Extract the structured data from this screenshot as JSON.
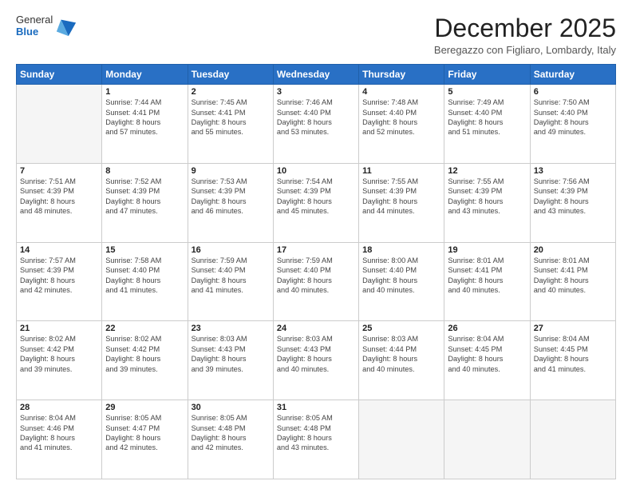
{
  "logo": {
    "general": "General",
    "blue": "Blue"
  },
  "title": "December 2025",
  "location": "Beregazzo con Figliaro, Lombardy, Italy",
  "days_of_week": [
    "Sunday",
    "Monday",
    "Tuesday",
    "Wednesday",
    "Thursday",
    "Friday",
    "Saturday"
  ],
  "weeks": [
    [
      {
        "day": "",
        "info": [],
        "empty": true
      },
      {
        "day": "1",
        "info": [
          "Sunrise: 7:44 AM",
          "Sunset: 4:41 PM",
          "Daylight: 8 hours",
          "and 57 minutes."
        ]
      },
      {
        "day": "2",
        "info": [
          "Sunrise: 7:45 AM",
          "Sunset: 4:41 PM",
          "Daylight: 8 hours",
          "and 55 minutes."
        ]
      },
      {
        "day": "3",
        "info": [
          "Sunrise: 7:46 AM",
          "Sunset: 4:40 PM",
          "Daylight: 8 hours",
          "and 53 minutes."
        ]
      },
      {
        "day": "4",
        "info": [
          "Sunrise: 7:48 AM",
          "Sunset: 4:40 PM",
          "Daylight: 8 hours",
          "and 52 minutes."
        ]
      },
      {
        "day": "5",
        "info": [
          "Sunrise: 7:49 AM",
          "Sunset: 4:40 PM",
          "Daylight: 8 hours",
          "and 51 minutes."
        ]
      },
      {
        "day": "6",
        "info": [
          "Sunrise: 7:50 AM",
          "Sunset: 4:40 PM",
          "Daylight: 8 hours",
          "and 49 minutes."
        ]
      }
    ],
    [
      {
        "day": "7",
        "info": [
          "Sunrise: 7:51 AM",
          "Sunset: 4:39 PM",
          "Daylight: 8 hours",
          "and 48 minutes."
        ]
      },
      {
        "day": "8",
        "info": [
          "Sunrise: 7:52 AM",
          "Sunset: 4:39 PM",
          "Daylight: 8 hours",
          "and 47 minutes."
        ]
      },
      {
        "day": "9",
        "info": [
          "Sunrise: 7:53 AM",
          "Sunset: 4:39 PM",
          "Daylight: 8 hours",
          "and 46 minutes."
        ]
      },
      {
        "day": "10",
        "info": [
          "Sunrise: 7:54 AM",
          "Sunset: 4:39 PM",
          "Daylight: 8 hours",
          "and 45 minutes."
        ]
      },
      {
        "day": "11",
        "info": [
          "Sunrise: 7:55 AM",
          "Sunset: 4:39 PM",
          "Daylight: 8 hours",
          "and 44 minutes."
        ]
      },
      {
        "day": "12",
        "info": [
          "Sunrise: 7:55 AM",
          "Sunset: 4:39 PM",
          "Daylight: 8 hours",
          "and 43 minutes."
        ]
      },
      {
        "day": "13",
        "info": [
          "Sunrise: 7:56 AM",
          "Sunset: 4:39 PM",
          "Daylight: 8 hours",
          "and 43 minutes."
        ]
      }
    ],
    [
      {
        "day": "14",
        "info": [
          "Sunrise: 7:57 AM",
          "Sunset: 4:39 PM",
          "Daylight: 8 hours",
          "and 42 minutes."
        ]
      },
      {
        "day": "15",
        "info": [
          "Sunrise: 7:58 AM",
          "Sunset: 4:40 PM",
          "Daylight: 8 hours",
          "and 41 minutes."
        ]
      },
      {
        "day": "16",
        "info": [
          "Sunrise: 7:59 AM",
          "Sunset: 4:40 PM",
          "Daylight: 8 hours",
          "and 41 minutes."
        ]
      },
      {
        "day": "17",
        "info": [
          "Sunrise: 7:59 AM",
          "Sunset: 4:40 PM",
          "Daylight: 8 hours",
          "and 40 minutes."
        ]
      },
      {
        "day": "18",
        "info": [
          "Sunrise: 8:00 AM",
          "Sunset: 4:40 PM",
          "Daylight: 8 hours",
          "and 40 minutes."
        ]
      },
      {
        "day": "19",
        "info": [
          "Sunrise: 8:01 AM",
          "Sunset: 4:41 PM",
          "Daylight: 8 hours",
          "and 40 minutes."
        ]
      },
      {
        "day": "20",
        "info": [
          "Sunrise: 8:01 AM",
          "Sunset: 4:41 PM",
          "Daylight: 8 hours",
          "and 40 minutes."
        ]
      }
    ],
    [
      {
        "day": "21",
        "info": [
          "Sunrise: 8:02 AM",
          "Sunset: 4:42 PM",
          "Daylight: 8 hours",
          "and 39 minutes."
        ]
      },
      {
        "day": "22",
        "info": [
          "Sunrise: 8:02 AM",
          "Sunset: 4:42 PM",
          "Daylight: 8 hours",
          "and 39 minutes."
        ]
      },
      {
        "day": "23",
        "info": [
          "Sunrise: 8:03 AM",
          "Sunset: 4:43 PM",
          "Daylight: 8 hours",
          "and 39 minutes."
        ]
      },
      {
        "day": "24",
        "info": [
          "Sunrise: 8:03 AM",
          "Sunset: 4:43 PM",
          "Daylight: 8 hours",
          "and 40 minutes."
        ]
      },
      {
        "day": "25",
        "info": [
          "Sunrise: 8:03 AM",
          "Sunset: 4:44 PM",
          "Daylight: 8 hours",
          "and 40 minutes."
        ]
      },
      {
        "day": "26",
        "info": [
          "Sunrise: 8:04 AM",
          "Sunset: 4:45 PM",
          "Daylight: 8 hours",
          "and 40 minutes."
        ]
      },
      {
        "day": "27",
        "info": [
          "Sunrise: 8:04 AM",
          "Sunset: 4:45 PM",
          "Daylight: 8 hours",
          "and 41 minutes."
        ]
      }
    ],
    [
      {
        "day": "28",
        "info": [
          "Sunrise: 8:04 AM",
          "Sunset: 4:46 PM",
          "Daylight: 8 hours",
          "and 41 minutes."
        ]
      },
      {
        "day": "29",
        "info": [
          "Sunrise: 8:05 AM",
          "Sunset: 4:47 PM",
          "Daylight: 8 hours",
          "and 42 minutes."
        ]
      },
      {
        "day": "30",
        "info": [
          "Sunrise: 8:05 AM",
          "Sunset: 4:48 PM",
          "Daylight: 8 hours",
          "and 42 minutes."
        ]
      },
      {
        "day": "31",
        "info": [
          "Sunrise: 8:05 AM",
          "Sunset: 4:48 PM",
          "Daylight: 8 hours",
          "and 43 minutes."
        ]
      },
      {
        "day": "",
        "info": [],
        "empty": true
      },
      {
        "day": "",
        "info": [],
        "empty": true
      },
      {
        "day": "",
        "info": [],
        "empty": true
      }
    ]
  ]
}
